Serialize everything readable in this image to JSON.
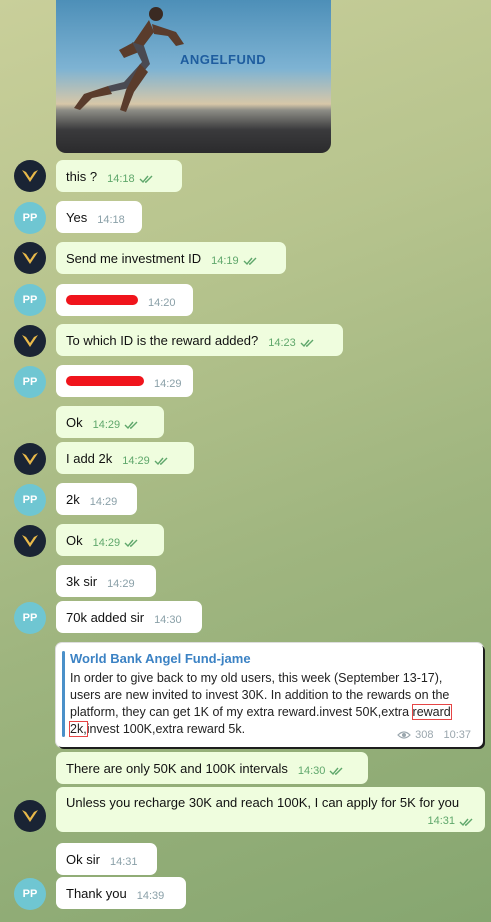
{
  "photo": {
    "brand": "ANGELFUND"
  },
  "messages": [
    {
      "sender": "angel",
      "text": "this ?",
      "time": "14:18"
    },
    {
      "sender": "pp",
      "text": "Yes",
      "time": "14:18"
    },
    {
      "sender": "angel",
      "text": "Send me investment ID",
      "time": "14:19"
    },
    {
      "sender": "pp",
      "text": "",
      "time": "14:20"
    },
    {
      "sender": "angel",
      "text": "To which ID is the reward added?",
      "time": "14:23"
    },
    {
      "sender": "pp",
      "text": "",
      "time": "14:29"
    },
    {
      "sender": "angel",
      "text": "Ok",
      "time": "14:29"
    },
    {
      "sender": "angel",
      "text": "I add 2k",
      "time": "14:29"
    },
    {
      "sender": "pp",
      "text": "2k",
      "time": "14:29"
    },
    {
      "sender": "angel",
      "text": "Ok",
      "time": "14:29"
    },
    {
      "sender": "pp",
      "text": "3k sir",
      "time": "14:29"
    },
    {
      "sender": "pp",
      "text": "70k added sir",
      "time": "14:30"
    },
    {
      "sender": "angel",
      "text": "There are only 50K and 100K intervals",
      "time": "14:30"
    },
    {
      "sender": "angel",
      "text": "Unless you recharge 30K and reach 100K, I can apply for 5K for you",
      "time": "14:31"
    },
    {
      "sender": "pp",
      "text": "Ok sir",
      "time": "14:31"
    },
    {
      "sender": "pp",
      "text": "Thank you",
      "time": "14:39"
    }
  ],
  "avatar_pp": "PP",
  "forwarded": {
    "title": "World Bank Angel Fund-jame",
    "text_a": "In order to give back to my old users, this week (September 13-17), users are new invited to invest 30K. In addition to the rewards on the platform, they can get 1K of my extra reward.invest 50K,extra ",
    "text_hl": "reward 2k,",
    "text_b": "invest 100K,extra reward 5k.",
    "views": "308",
    "time": "10:37"
  },
  "colors": {
    "outgoing": "#effdde",
    "incoming": "#ffffff",
    "tick": "#5fa76b",
    "pp_avatar": "#6fc6d2",
    "redaction": "#f0141c"
  }
}
